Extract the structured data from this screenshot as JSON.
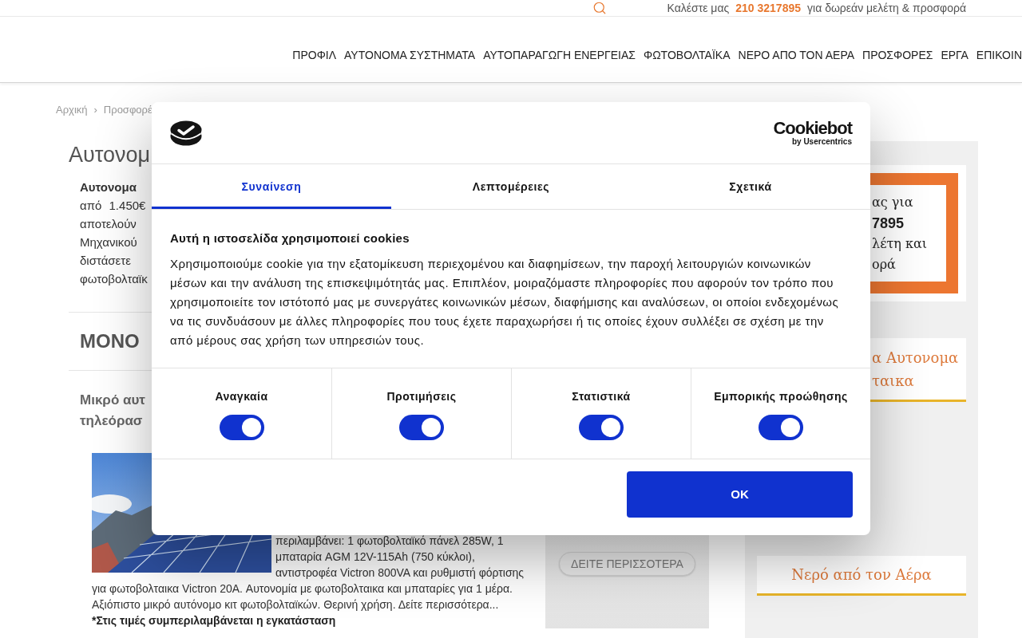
{
  "top_bar": {
    "call_prefix": "Καλέστε μας",
    "phone": "210 3217895",
    "call_suffix": "για δωρεάν μελέτη & προσφορά"
  },
  "nav": {
    "items": [
      "ΠΡΟΦΙΛ",
      "ΑΥΤΟΝΟΜΑ ΣΥΣΤΗΜΑΤΑ",
      "ΑΥΤΟΠΑΡΑΓΩΓΗ ΕΝΕΡΓΕΙΑΣ",
      "ΦΩΤΟΒΟΛΤΑΪΚΑ",
      "ΝΕΡΟ ΑΠΟ ΤΟΝ ΑΕΡΑ",
      "ΠΡΟΣΦΟΡΕΣ",
      "ΕΡΓΑ",
      "ΕΠΙΚΟΙΝ"
    ]
  },
  "breadcrumb": {
    "items": [
      "Αρχική",
      "Προσφορέ"
    ],
    "separator": "›"
  },
  "content": {
    "title": "Αυτονομ",
    "intro_lines": [
      {
        "text": "Αυτονομα",
        "bold": true
      },
      {
        "text": "από 1.450€",
        "bold": false
      },
      {
        "text": "αποτελούν",
        "bold": false
      },
      {
        "text": "Μηχανικού",
        "bold": false
      },
      {
        "text": "διστάσετε",
        "bold": false
      },
      {
        "text": "φωτοβολταϊκ",
        "bold": false
      }
    ],
    "section_heading": "ΜΟΝΟ",
    "product": {
      "title_lines": [
        "Μικρό αυτ",
        "τηλεόρασ"
      ],
      "text_beside_image": "περιλαμβάνει: 1 φωτοβολταϊκό πάνελ 285W, 1 μπαταρία AGM 12V-115Ah (750 κύκλοι), αντιστροφέα Victron 800VA και ρυθμιστή φόρτισης",
      "text_below_image": "για φωτοβολταικα Victron 20A. Αυτονομία με φωτοβολταικα και μπαταρίες για 1 μέρα. Αξιόπιστο μικρό αυτόνομο κιτ φωτοβολταϊκών. Θερινή χρήση. Δείτε περισσότερα...",
      "note": "*Στις τιμές συμπεριλαμβάνεται η εγκατάσταση",
      "more_button": "ΔΕΙΤΕ ΠΕΡΙΣΣΟΤΕΡΑ"
    }
  },
  "sidebar": {
    "contact_box": {
      "lines": [
        {
          "text": "ας για",
          "bold": false
        },
        {
          "text": "7895",
          "bold": true
        },
        {
          "text": "λέτη και",
          "bold": false
        },
        {
          "text": "ορά",
          "bold": false
        }
      ]
    },
    "products_card": {
      "lines": [
        "α Αυτονομα",
        "ταικα"
      ]
    },
    "water_card": {
      "title": "Νερό από τον Αέρα"
    }
  },
  "cookie_dialog": {
    "brand": {
      "name": "Cookiebot",
      "tagline": "by Usercentrics"
    },
    "tabs": [
      {
        "label": "Συναίνεση",
        "selected": true
      },
      {
        "label": "Λεπτομέρειες",
        "selected": false
      },
      {
        "label": "Σχετικά",
        "selected": false
      }
    ],
    "heading": "Αυτή η ιστοσελίδα χρησιμοποιεί cookies",
    "body": "Χρησιμοποιούμε cookie για την εξατομίκευση περιεχομένου και διαφημίσεων, την παροχή λειτουργιών κοινωνικών μέσων και την ανάλυση της επισκεψιμότητάς μας. Επιπλέον, μοιραζόμαστε πληροφορίες που αφορούν τον τρόπο που χρησιμοποιείτε τον ιστότοπό μας με συνεργάτες κοινωνικών μέσων, διαφήμισης και αναλύσεων, οι οποίοι ενδεχομένως να τις συνδυάσουν με άλλες πληροφορίες που τους έχετε παραχωρήσει ή τις οποίες έχουν συλλέξει σε σχέση με την από μέρους σας χρήση των υπηρεσιών τους.",
    "toggles": [
      {
        "label": "Αναγκαία",
        "checked": true
      },
      {
        "label": "Προτιμήσεις",
        "checked": true
      },
      {
        "label": "Στατιστικά",
        "checked": true
      },
      {
        "label": "Εμπορικής προώθησης",
        "checked": true
      }
    ],
    "ok_button": "OK"
  }
}
